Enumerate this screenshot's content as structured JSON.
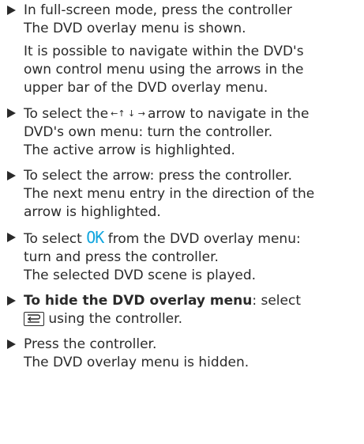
{
  "steps": [
    {
      "line1": "In full-screen mode, press the controller",
      "line2": "The DVD overlay menu is shown."
    }
  ],
  "note": {
    "line1": "It is possible to navigate within the DVD's",
    "line2": "own control menu using the arrows in the",
    "line3": "upper bar of the DVD overlay menu."
  },
  "step2": {
    "line1_pre": "To select the",
    "arrow_glyphs": "←↑ ↓ →",
    "line1_post": "arrow to navigate in the",
    "line2": "DVD's own menu: turn the controller.",
    "line3": "The active arrow is highlighted."
  },
  "step3": {
    "line1": "To select the arrow: press the controller.",
    "line2": "The next menu entry in the direction of the",
    "line3": "arrow is highlighted."
  },
  "step4": {
    "line1_pre": "To select",
    "ok_label": "OK",
    "line1_post": "from the DVD overlay menu:",
    "line2": "turn and press the controller.",
    "line3": "The selected DVD scene is played."
  },
  "step5": {
    "bold": "To hide the DVD overlay menu",
    "line1_post": ": select",
    "back_icon": "back-arrow-icon",
    "line2_post": "using the controller."
  },
  "step6": {
    "line1": "Press the controller.",
    "line2": "The DVD overlay menu is hidden."
  },
  "colors": {
    "text": "#2a2a2a",
    "ok_accent": "#11a6df"
  }
}
